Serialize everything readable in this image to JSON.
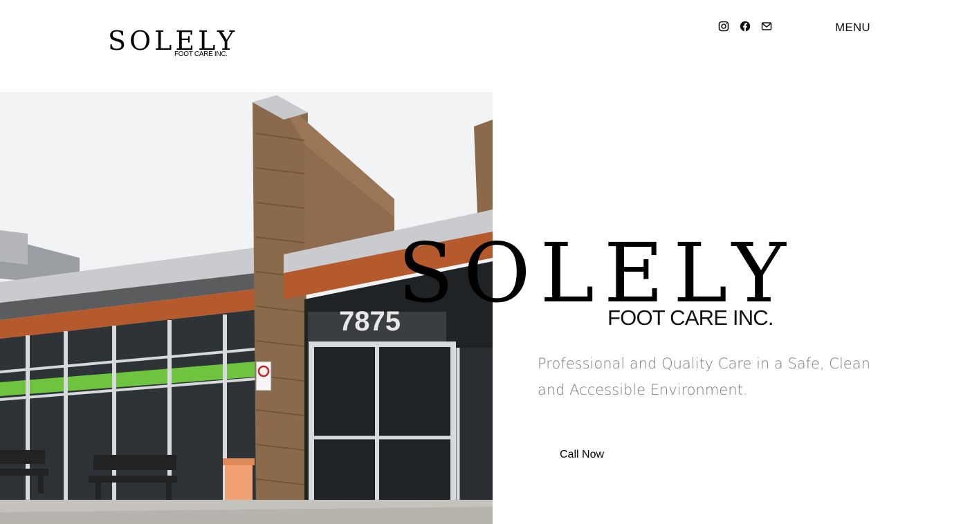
{
  "header": {
    "logo": {
      "word": "SOLELY",
      "sub": "FOOT CARE INC."
    },
    "socials": [
      {
        "icon": "instagram-icon"
      },
      {
        "icon": "facebook-icon"
      },
      {
        "icon": "mail-icon"
      }
    ],
    "menu_label": "MENU"
  },
  "hero": {
    "photo": {
      "building_number": "7875"
    },
    "logo": {
      "word": "SOLELY",
      "sub": "FOOT CARE INC."
    },
    "tagline": "Professional and Quality Care in a Safe, Clean and Accessible Environment.",
    "cta_label": "Call Now"
  },
  "colors": {
    "tagline": "#7b7b7b",
    "background": "#ffffff",
    "text": "#000000"
  }
}
